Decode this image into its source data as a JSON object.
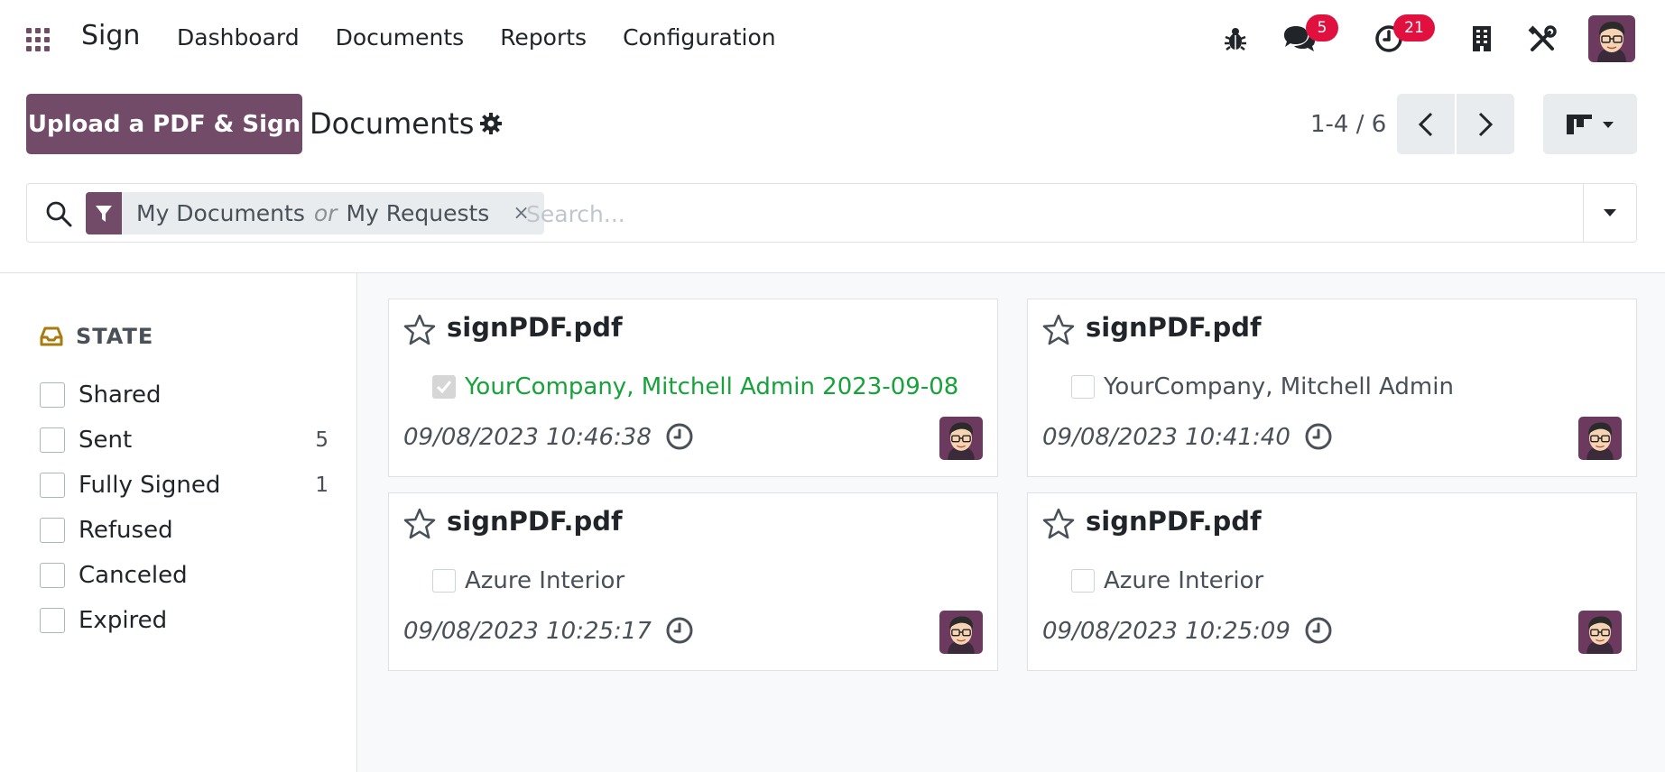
{
  "navbar": {
    "brand": "Sign",
    "menu": [
      "Dashboard",
      "Documents",
      "Reports",
      "Configuration"
    ],
    "messages_badge": "5",
    "activities_badge": "21"
  },
  "control_panel": {
    "upload_button": "Upload a PDF & Sign",
    "title": "Documents",
    "pager": "1-4 / 6"
  },
  "search": {
    "facet_values": [
      "My Documents",
      "My Requests"
    ],
    "facet_separator": "or",
    "facet_remove": "×",
    "placeholder": "Search..."
  },
  "side_panel": {
    "title": "STATE",
    "items": [
      {
        "label": "Shared",
        "count": ""
      },
      {
        "label": "Sent",
        "count": "5"
      },
      {
        "label": "Fully Signed",
        "count": "1"
      },
      {
        "label": "Refused",
        "count": ""
      },
      {
        "label": "Canceled",
        "count": ""
      },
      {
        "label": "Expired",
        "count": ""
      }
    ]
  },
  "cards": [
    {
      "title": "signPDF.pdf",
      "signer": "YourCompany, Mitchell Admin 2023-09-08",
      "signed": true,
      "date": "09/08/2023 10:46:38"
    },
    {
      "title": "signPDF.pdf",
      "signer": "YourCompany, Mitchell Admin",
      "signed": false,
      "date": "09/08/2023 10:41:40"
    },
    {
      "title": "signPDF.pdf",
      "signer": "Azure Interior",
      "signed": false,
      "date": "09/08/2023 10:25:17"
    },
    {
      "title": "signPDF.pdf",
      "signer": "Azure Interior",
      "signed": false,
      "date": "09/08/2023 10:25:09"
    }
  ],
  "colors": {
    "brand": "#714b67",
    "badge": "#e0113f",
    "signed_text": "#18a23b",
    "state_icon": "#a77b0c"
  }
}
